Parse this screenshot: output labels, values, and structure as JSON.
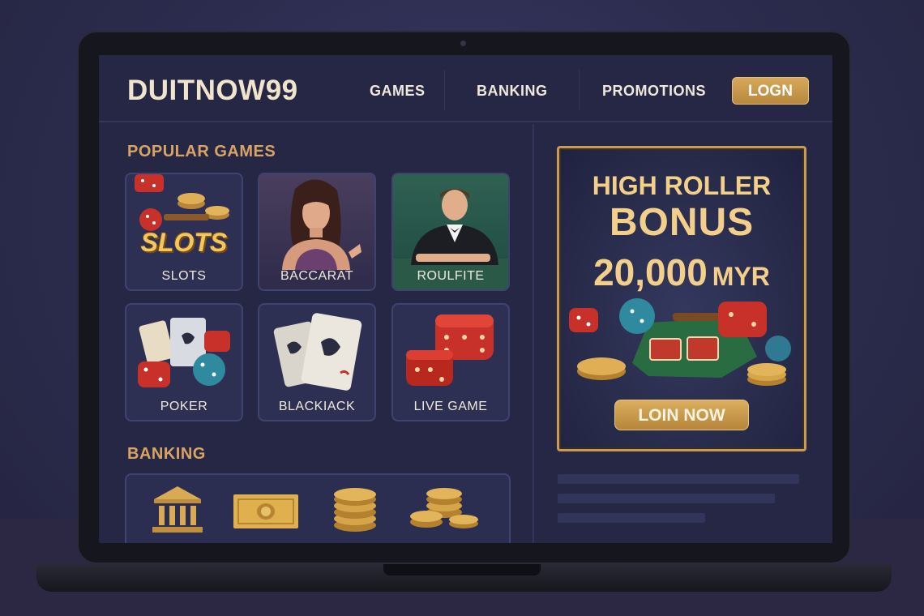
{
  "header": {
    "logo": "DUITNOW99",
    "nav": [
      "GAMES",
      "BANKING",
      "PROMOTIONS"
    ],
    "login_label": "LOGN"
  },
  "popular_games": {
    "title": "POPULAR GAMES",
    "tiles": [
      {
        "label": "SLOTS",
        "art_text": "SLOTS"
      },
      {
        "label": "BACCARAT"
      },
      {
        "label": "ROULFITE"
      },
      {
        "label": "POKER"
      },
      {
        "label": "BLACKIACK"
      },
      {
        "label": "LIVE GAME"
      }
    ]
  },
  "banking": {
    "title": "BANKING",
    "icons": [
      "bank-icon",
      "banknote-icon",
      "coin-stack-icon",
      "coin-piles-icon"
    ]
  },
  "promo": {
    "line1": "HIGH ROLLER",
    "line2": "BONUS",
    "amount": "20,000",
    "currency": "MYR",
    "cta_label": "LOIN NOW"
  },
  "colors": {
    "accent_gold": "#d9a463",
    "screen_bg": "#252745",
    "button_gold": "#c89a52"
  }
}
